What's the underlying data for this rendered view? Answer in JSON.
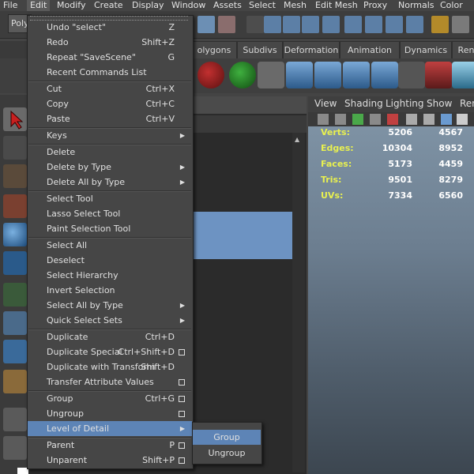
{
  "menubar": [
    "File",
    "Edit",
    "Modify",
    "Create",
    "Display",
    "Window",
    "Assets",
    "Select",
    "Mesh",
    "Edit Mesh",
    "Proxy",
    "Normals",
    "Color"
  ],
  "active_menu": "Edit",
  "toolbar": {
    "mode_dropdown": "Poly"
  },
  "shelf_tabs": [
    "olygons",
    "Subdivs",
    "Deformation",
    "Animation",
    "Dynamics",
    "Ren"
  ],
  "viewport": {
    "menu": [
      "View",
      "Shading",
      "Lighting",
      "Show",
      "Ren"
    ],
    "hud": [
      {
        "label": "Verts:",
        "a": "5206",
        "b": "4567"
      },
      {
        "label": "Edges:",
        "a": "10304",
        "b": "8952"
      },
      {
        "label": "Faces:",
        "a": "5173",
        "b": "4459"
      },
      {
        "label": "Tris:",
        "a": "9501",
        "b": "8279"
      },
      {
        "label": "UVs:",
        "a": "7334",
        "b": "6560"
      }
    ]
  },
  "edit_menu": {
    "items": [
      {
        "label": "Undo \"select\"",
        "shortcut": "Z"
      },
      {
        "label": "Redo",
        "shortcut": "Shift+Z"
      },
      {
        "label": "Repeat \"SaveScene\"",
        "shortcut": "G"
      },
      {
        "label": "Recent Commands List",
        "shortcut": ""
      },
      {
        "label": "Cut",
        "shortcut": "Ctrl+X"
      },
      {
        "label": "Copy",
        "shortcut": "Ctrl+C"
      },
      {
        "label": "Paste",
        "shortcut": "Ctrl+V"
      },
      {
        "label": "Keys",
        "shortcut": "",
        "submenu": true
      },
      {
        "label": "Delete",
        "shortcut": ""
      },
      {
        "label": "Delete by Type",
        "shortcut": "",
        "submenu": true
      },
      {
        "label": "Delete All by Type",
        "shortcut": "",
        "submenu": true
      },
      {
        "label": "Select Tool",
        "shortcut": ""
      },
      {
        "label": "Lasso Select Tool",
        "shortcut": ""
      },
      {
        "label": "Paint Selection Tool",
        "shortcut": ""
      },
      {
        "label": "Select All",
        "shortcut": ""
      },
      {
        "label": "Deselect",
        "shortcut": ""
      },
      {
        "label": "Select Hierarchy",
        "shortcut": ""
      },
      {
        "label": "Invert Selection",
        "shortcut": ""
      },
      {
        "label": "Select All by Type",
        "shortcut": "",
        "submenu": true
      },
      {
        "label": "Quick Select Sets",
        "shortcut": "",
        "submenu": true
      },
      {
        "label": "Duplicate",
        "shortcut": "Ctrl+D"
      },
      {
        "label": "Duplicate Special",
        "shortcut": "Ctrl+Shift+D",
        "option": true
      },
      {
        "label": "Duplicate with Transform",
        "shortcut": "Shift+D"
      },
      {
        "label": "Transfer Attribute Values",
        "shortcut": "",
        "option": true
      },
      {
        "label": "Group",
        "shortcut": "Ctrl+G",
        "option": true
      },
      {
        "label": "Ungroup",
        "shortcut": "",
        "option": true
      },
      {
        "label": "Level of Detail",
        "shortcut": "",
        "submenu": true,
        "highlighted": true
      },
      {
        "label": "Parent",
        "shortcut": "P",
        "option": true
      },
      {
        "label": "Unparent",
        "shortcut": "Shift+P",
        "option": true
      }
    ]
  },
  "lod_submenu": {
    "items": [
      {
        "label": "Group",
        "highlighted": true
      },
      {
        "label": "Ungroup"
      }
    ]
  },
  "colors": {
    "highlight": "#5d84b6",
    "hud_label": "#e8f050"
  }
}
